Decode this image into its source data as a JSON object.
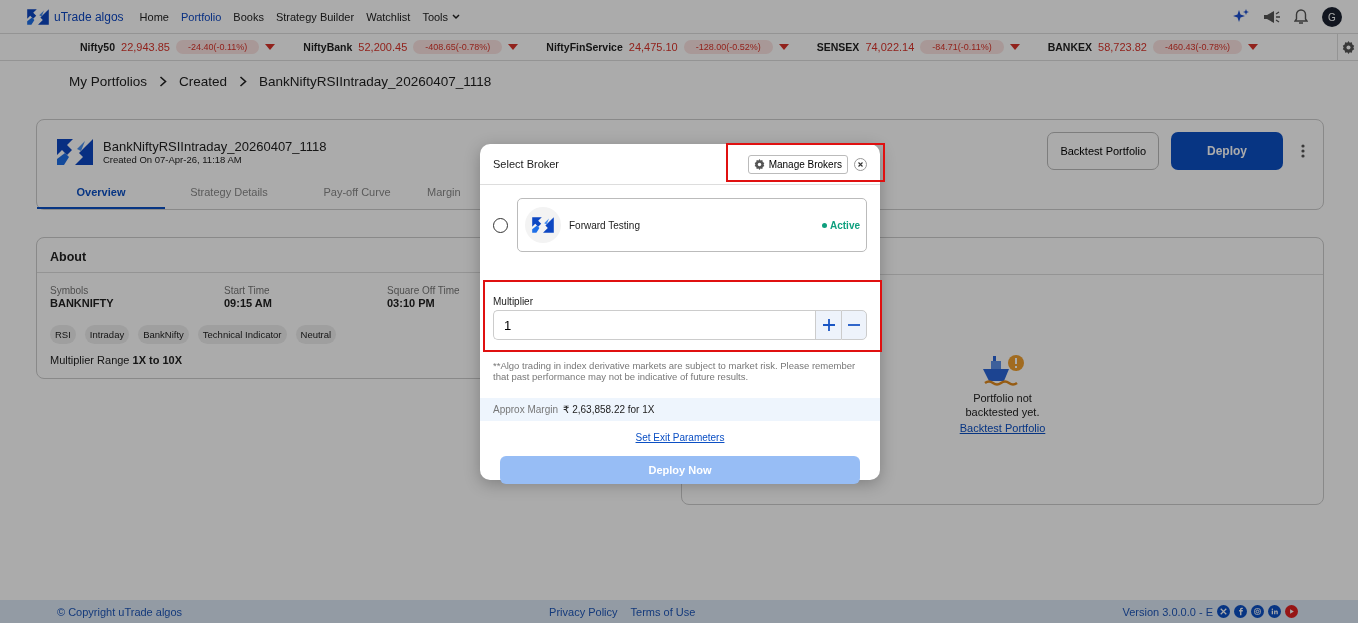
{
  "header": {
    "brand": "uTrade algos",
    "nav": [
      {
        "label": "Home",
        "selected": false,
        "kind": "link"
      },
      {
        "label": "Portfolio",
        "selected": true,
        "kind": "link"
      },
      {
        "label": "Books",
        "selected": false,
        "kind": "link"
      },
      {
        "label": "Strategy Builder",
        "selected": false,
        "kind": "link"
      },
      {
        "label": "Watchlist",
        "selected": false,
        "kind": "link"
      },
      {
        "label": "Tools",
        "selected": false,
        "kind": "dropdown"
      }
    ],
    "avatar": "G"
  },
  "ticker": [
    {
      "name": "Nifty50",
      "price": "22,943.85",
      "change": "-24.40(-0.11%)",
      "falling": true
    },
    {
      "name": "NiftyBank",
      "price": "52,200.45",
      "change": "-408.65(-0.78%)",
      "falling": true
    },
    {
      "name": "NiftyFinService",
      "price": "24,475.10",
      "change": "-128.00(-0.52%)",
      "falling": true
    },
    {
      "name": "SENSEX",
      "price": "74,022.14",
      "change": "-84.71(-0.11%)",
      "falling": true
    },
    {
      "name": "BANKEX",
      "price": "58,723.82",
      "change": "-460.43(-0.78%)",
      "falling": true
    }
  ],
  "breadcrumb": [
    "My Portfolios",
    "Created",
    "BankNiftyRSIIntraday_20260407_1118"
  ],
  "portfolio": {
    "title": "BankNiftyRSIIntraday_20260407_1118",
    "created": "Created On 07-Apr-26, 11:18 AM",
    "tabs": [
      {
        "label": "Overview",
        "selected": true
      },
      {
        "label": "Strategy Details",
        "selected": false
      },
      {
        "label": "Pay-off Curve",
        "selected": false
      },
      {
        "label": "Margin",
        "selected": false
      }
    ],
    "backtest_button": "Backtest Portfolio",
    "deploy_button": "Deploy"
  },
  "about": {
    "title": "About",
    "fields": [
      {
        "label": "Symbols",
        "value": "BANKNIFTY"
      },
      {
        "label": "Start Time",
        "value": "09:15 AM"
      },
      {
        "label": "Square Off Time",
        "value": "03:10 PM"
      }
    ],
    "tags": [
      "RSI",
      "Intraday",
      "BankNifty",
      "Technical Indicator",
      "Neutral"
    ],
    "multiplier_range": "Multiplier Range **1X to 10X**"
  },
  "backtest_panel": {
    "message": "Portfolio not backtested yet.",
    "link": "Backtest Portfolio"
  },
  "modal": {
    "title": "Select Broker",
    "manage_button": "Manage Brokers",
    "manage_highlighted": true,
    "brokers": [
      {
        "name": "Forward Testing",
        "status": "Active",
        "selected": false
      }
    ],
    "multiplier": {
      "label": "Multiplier",
      "value": "1",
      "highlighted": true
    },
    "disclaimer": "**Algo trading in index derivative markets are subject to market risk. Please remember that past performance may not be indicative of future results.",
    "margin_label": "Approx Margin",
    "margin_value": "₹ 2,63,858.22 for 1X",
    "exit_link": "Set Exit Parameters",
    "deploy_button": {
      "label": "Deploy Now",
      "disabled": true
    }
  },
  "footer": {
    "copyright": "© Copyright uTrade algos",
    "links": [
      "Privacy Policy",
      "Terms of Use"
    ],
    "version": "Version 3.0.0.0 - E"
  }
}
